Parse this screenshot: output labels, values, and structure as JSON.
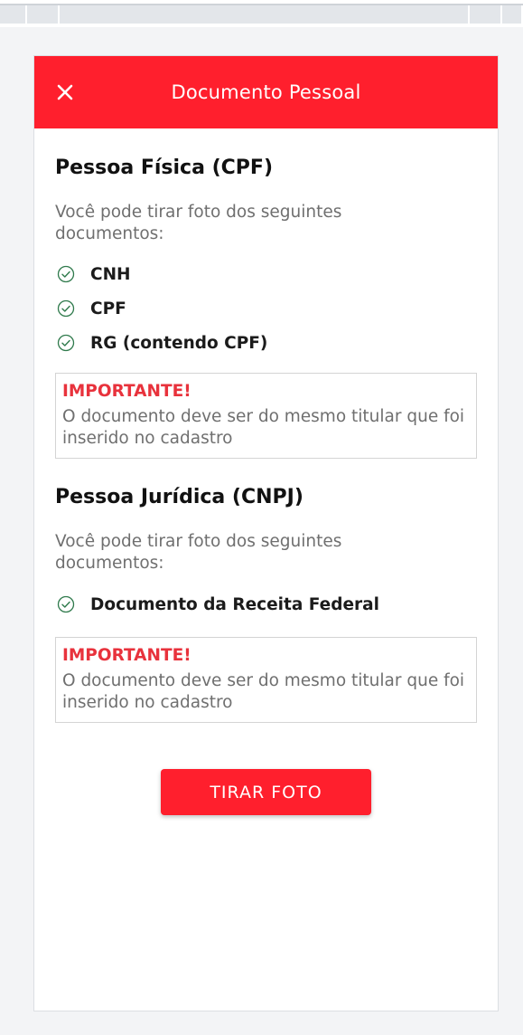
{
  "modal": {
    "title": "Documento Pessoal",
    "close_icon": "close-icon"
  },
  "pessoa_fisica": {
    "title": "Pessoa Física (CPF)",
    "description": "Você pode tirar foto dos seguintes documentos:",
    "documents": [
      "CNH",
      "CPF",
      "RG (contendo CPF)"
    ],
    "important_title": "IMPORTANTE!",
    "important_text": "O documento deve ser do mesmo titular que foi inserido no cadastro"
  },
  "pessoa_juridica": {
    "title": "Pessoa Jurídica (CNPJ)",
    "description": "Você pode tirar foto dos seguintes documentos:",
    "documents": [
      "Documento da Receita Federal"
    ],
    "important_title": "IMPORTANTE!",
    "important_text": "O documento deve ser do mesmo titular que foi inserido no cadastro"
  },
  "actions": {
    "take_photo_label": "TIRAR FOTO"
  },
  "colors": {
    "accent": "#ff1f2d",
    "important": "#e8323c",
    "check": "#2f7a4c",
    "muted_text": "#6f6f6f"
  },
  "icons": {
    "check": "check-circle-icon"
  }
}
